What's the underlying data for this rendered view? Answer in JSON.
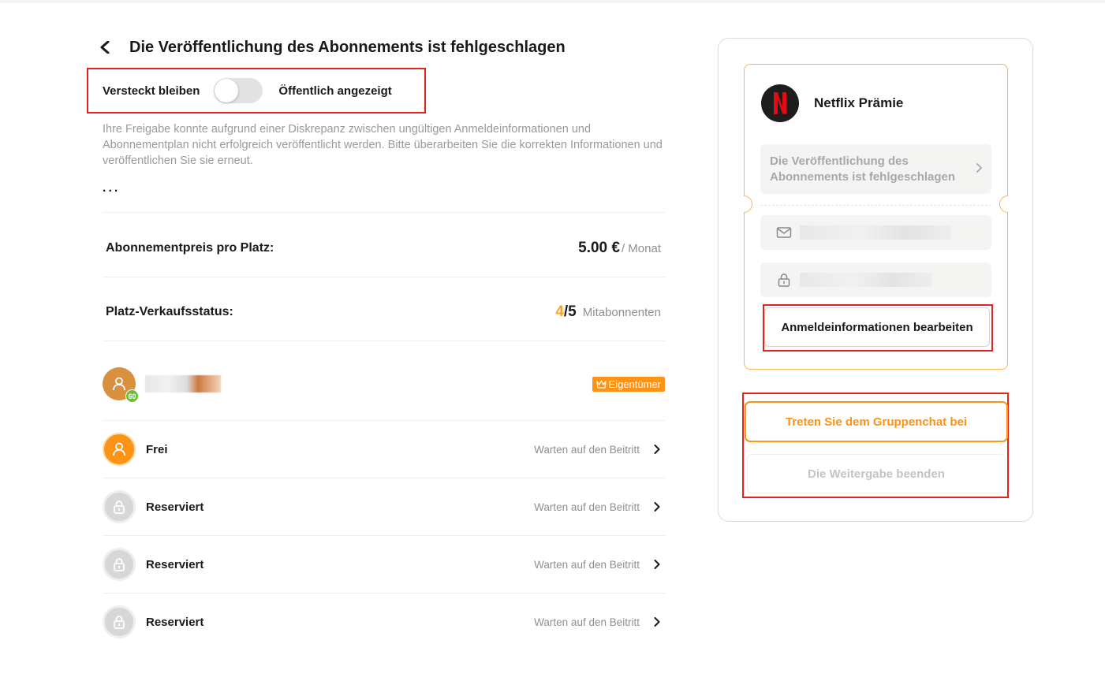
{
  "header": {
    "title": "Die Veröffentlichung des Abonnements ist fehlgeschlagen"
  },
  "visibility": {
    "hidden_label": "Versteckt bleiben",
    "public_label": "Öffentlich angezeigt",
    "is_public": false
  },
  "description": "Ihre Freigabe konnte aufgrund einer Diskrepanz zwischen ungültigen Anmeldeinformationen und Abonnementplan nicht erfolgreich veröffentlicht werden. Bitte überarbeiten Sie die korrekten Informationen und veröffentlichen Sie sie erneut.",
  "more": "...",
  "price": {
    "label": "Abonnementpreis pro Platz:",
    "value": "5.00 €",
    "unit": "/ Monat"
  },
  "seats": {
    "label": "Platz-Verkaufsstatus:",
    "sold": "4",
    "separator": "/",
    "total": "5",
    "unit": "Mitabonnenten"
  },
  "owner": {
    "level": "60",
    "badge": "Eigentümer"
  },
  "members": [
    {
      "name": "Frei",
      "status": "Warten auf den Beitritt",
      "kind": "free"
    },
    {
      "name": "Reserviert",
      "status": "Warten auf den Beitritt",
      "kind": "locked"
    },
    {
      "name": "Reserviert",
      "status": "Warten auf den Beitritt",
      "kind": "locked"
    },
    {
      "name": "Reserviert",
      "status": "Warten auf den Beitritt",
      "kind": "locked"
    }
  ],
  "panel": {
    "service_name": "Netflix Prämie",
    "status_text": "Die Veröffentlichung des Abonnements ist fehlgeschlagen",
    "edit_button": "Anmeldeinformationen bearbeiten",
    "join_button": "Treten Sie dem Gruppenchat bei",
    "stop_button": "Die Weitergabe beenden"
  },
  "colors": {
    "accent": "#fb9316",
    "highlight_box": "#e0241b",
    "netflix_red": "#e50914"
  }
}
